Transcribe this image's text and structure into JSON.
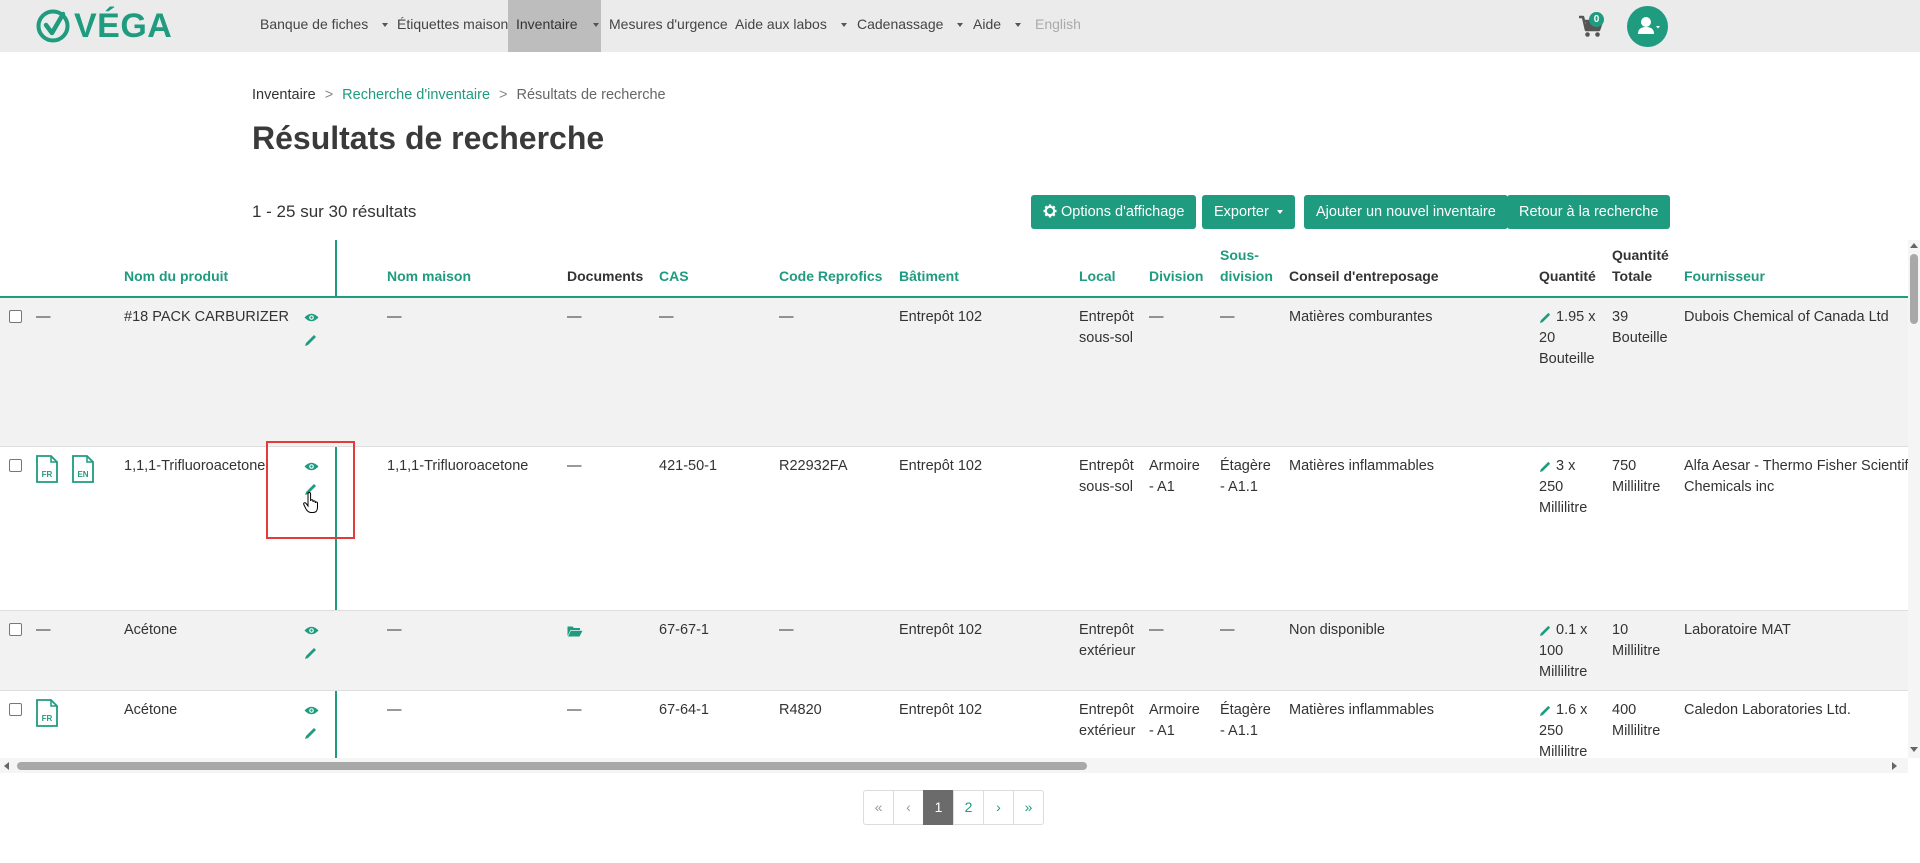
{
  "colors": {
    "accent": "#1f9b7f",
    "nav_bg": "#ebebeb",
    "nav_active": "#bdbdbd",
    "highlight": "#e23b3b"
  },
  "brand": {
    "name": "VÉGA"
  },
  "nav": {
    "items": [
      {
        "label": "Banque de fiches",
        "dropdown": true
      },
      {
        "label": "Étiquettes maison",
        "dropdown": false
      },
      {
        "label": "Inventaire",
        "dropdown": true,
        "active": true
      },
      {
        "label": "Mesures d'urgence",
        "dropdown": false
      },
      {
        "label": "Aide aux labos",
        "dropdown": true
      },
      {
        "label": "Cadenassage",
        "dropdown": true
      },
      {
        "label": "Aide",
        "dropdown": true
      },
      {
        "label": "English",
        "dropdown": false
      }
    ],
    "cart_count": "0",
    "cart_icon": "shopping-cart-icon",
    "user_icon": "user-icon"
  },
  "breadcrumb": {
    "items": [
      "Inventaire",
      "Recherche d'inventaire",
      "Résultats de recherche"
    ],
    "separator": ">"
  },
  "page": {
    "title": "Résultats de recherche",
    "result_count": "1 - 25 sur 30 résultats"
  },
  "buttons": {
    "display_options": "Options d'affichage",
    "export": "Exporter",
    "add_inventory": "Ajouter un nouvel inventaire",
    "back_to_search": "Retour à la recherche"
  },
  "table": {
    "columns": {
      "product": "Nom du produit",
      "house_name": "Nom maison",
      "documents": "Documents",
      "cas": "CAS",
      "reprofics": "Code Reprofics",
      "building": "Bâtiment",
      "room": "Local",
      "division": "Division",
      "subdivision": "Sous-division",
      "storage": "Conseil d'entreposage",
      "quantity": "Quantité",
      "total_qty": "Quantité Totale",
      "supplier": "Fournisseur"
    },
    "rows": [
      {
        "flag": "—",
        "product": "#18 PACK CARBURIZER",
        "house_name": "—",
        "documents": "—",
        "cas": "—",
        "reprofics": "—",
        "building": "Entrepôt 102",
        "room": [
          "Entrepôt",
          "sous-sol"
        ],
        "division": [
          "—"
        ],
        "subdivision": [
          "—"
        ],
        "storage": "Matières comburantes",
        "quantity": [
          "1.95 x",
          "20",
          "Bouteille"
        ],
        "total": [
          "39",
          "Bouteille"
        ],
        "supplier": [
          "Dubois Chemical of Canada Ltd"
        ]
      },
      {
        "flag": "",
        "doc_badges": [
          "FR",
          "EN"
        ],
        "product": "1,1,1-Trifluoroacetone",
        "house_name": "1,1,1-Trifluoroacetone",
        "documents": "—",
        "cas": "421-50-1",
        "reprofics": "R22932FA",
        "building": "Entrepôt 102",
        "room": [
          "Entrepôt",
          "sous-sol"
        ],
        "division": [
          "Armoire",
          "- A1"
        ],
        "subdivision": [
          "Étagère",
          "- A1.1"
        ],
        "storage": "Matières inflammables",
        "quantity": [
          "3 x",
          "250",
          "Millilitre"
        ],
        "total": [
          "750",
          "Millilitre"
        ],
        "supplier": [
          "Alfa Aesar - Thermo Fisher Scientific",
          "Chemicals inc"
        ]
      },
      {
        "flag": "—",
        "product": "Acétone",
        "house_name": "—",
        "documents": "",
        "cas": "67-67-1",
        "reprofics": "—",
        "building": "Entrepôt 102",
        "room": [
          "Entrepôt",
          "extérieur"
        ],
        "division": [
          "—"
        ],
        "subdivision": [
          "—"
        ],
        "storage": "Non disponible",
        "quantity": [
          "0.1 x",
          "100",
          "Millilitre"
        ],
        "total": [
          "10",
          "Millilitre"
        ],
        "supplier": [
          "Laboratoire MAT"
        ]
      },
      {
        "flag": "",
        "doc_badges": [
          "FR"
        ],
        "product": "Acétone",
        "house_name": "—",
        "documents": "—",
        "cas": "67-64-1",
        "reprofics": "R4820",
        "building": "Entrepôt 102",
        "room": [
          "Entrepôt",
          "extérieur"
        ],
        "division": [
          "Armoire",
          "- A1"
        ],
        "subdivision": [
          "Étagère",
          "- A1.1"
        ],
        "storage": "Matières inflammables",
        "quantity": [
          "1.6 x",
          "250",
          "Millilitre"
        ],
        "total": [
          "400",
          "Millilitre"
        ],
        "supplier": [
          "Caledon Laboratories Ltd."
        ]
      }
    ]
  },
  "pagination": {
    "first": "«",
    "prev": "‹",
    "pages": [
      "1",
      "2"
    ],
    "current": "1",
    "next": "›",
    "last": "»"
  }
}
